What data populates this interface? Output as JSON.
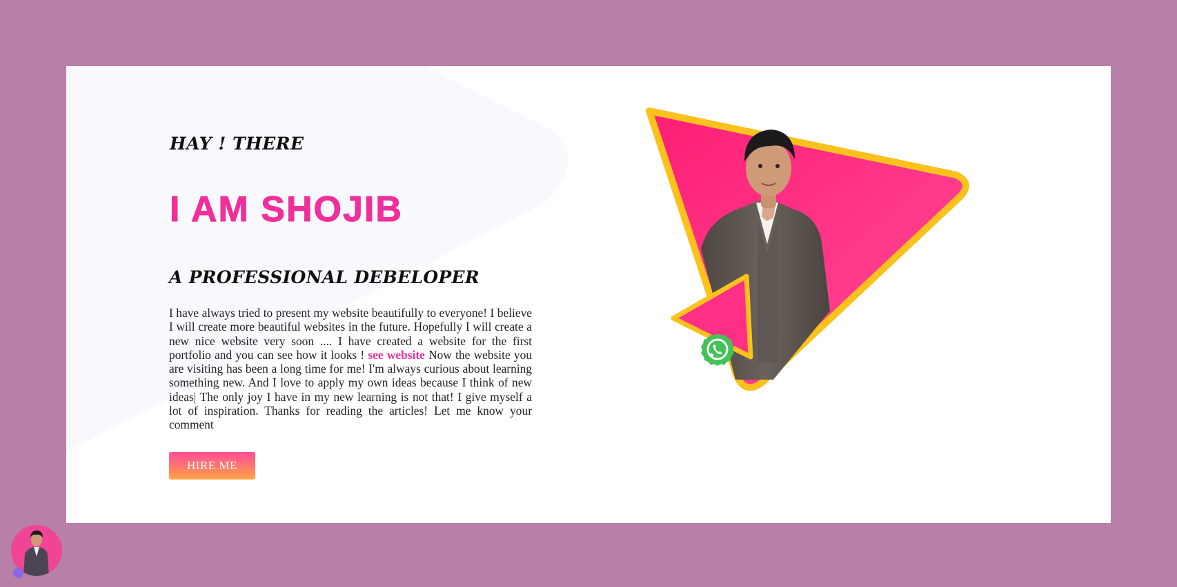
{
  "hero": {
    "greeting": "HAY ! THERE",
    "name": "I AM SHOJIB",
    "role": "A PROFESSIONAL DEBELOPER",
    "bio_before_link": "I have always tried to present my website beautifully to everyone! I believe I will create more beautiful websites in the future. Hopefully I will create a new nice website very soon .... I have created a website for the first portfolio and you can see how it looks ! ",
    "bio_link": "see website",
    "bio_after_link": " Now the website you are visiting has been a long time for me! I'm always curious about learning something new. And I love to apply my own ideas because I think of new ideas| The only joy I have in my new learning is not that! I give myself a lot of inspiration. Thanks for reading the articles! Let me know your comment",
    "cta_label": "HIRE ME"
  },
  "icons": {
    "contact": "whatsapp-icon",
    "profile": "avatar"
  },
  "colors": {
    "page_background": "#b87fa8",
    "accent": "#f0309a",
    "triangle_fill": "#ff2f85",
    "triangle_border": "#fbc11c",
    "whatsapp": "#43c257"
  }
}
